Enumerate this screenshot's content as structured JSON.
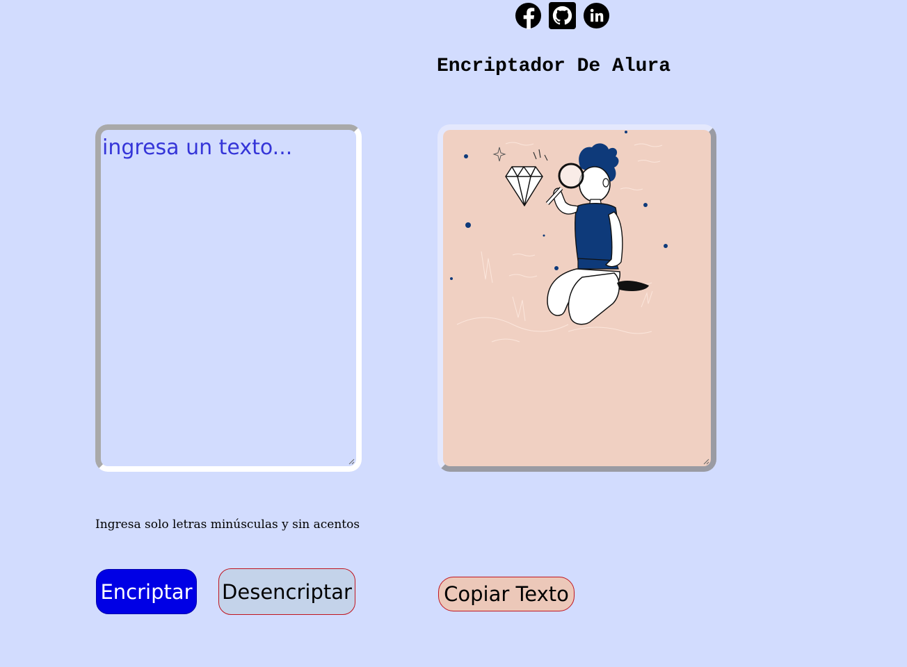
{
  "social": {
    "icons": [
      "facebook-icon",
      "github-icon",
      "linkedin-icon"
    ]
  },
  "header": {
    "title": "Encriptador De Alura"
  },
  "input": {
    "placeholder": "ingresa un texto..."
  },
  "hint": {
    "text": "Ingresa solo letras minúsculas y sin acentos"
  },
  "buttons": {
    "encrypt_label": "Encriptar",
    "decrypt_label": "Desencriptar",
    "copy_label": "Copiar Texto"
  },
  "colors": {
    "background": "#d2dcfe",
    "encrypt_button": "#0000e5",
    "decrypt_button": "#c4d3ea",
    "copy_button": "#ecc8b9",
    "output_panel": "#f0d0c2",
    "placeholder_text": "#3535d8"
  }
}
